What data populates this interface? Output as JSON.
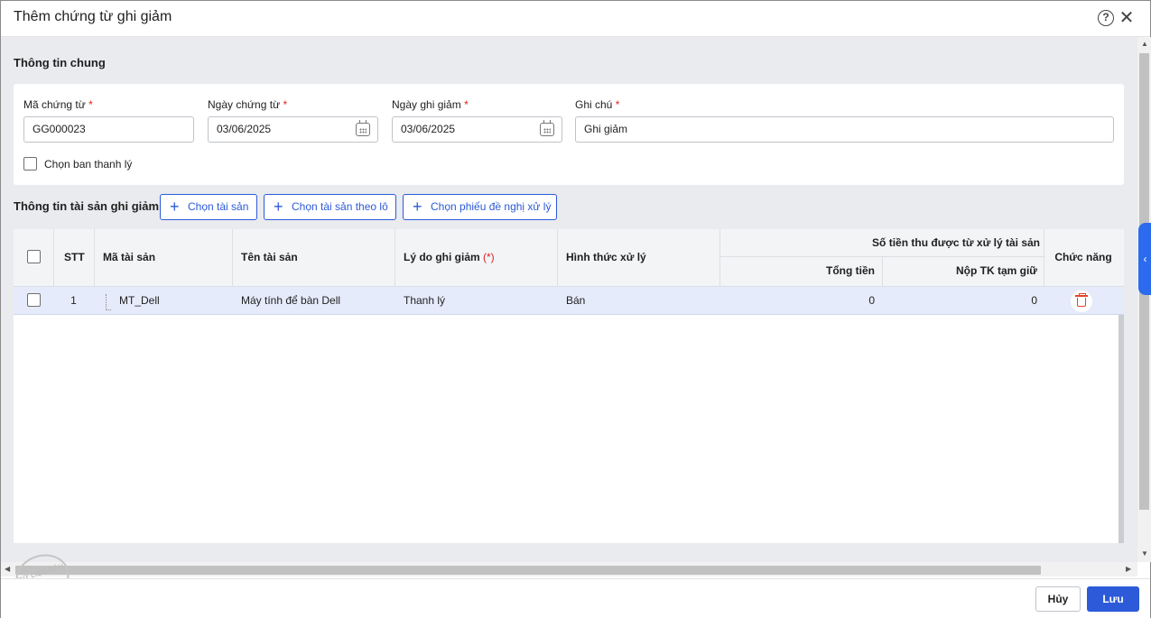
{
  "header": {
    "title": "Thêm chứng từ ghi giảm"
  },
  "general": {
    "title": "Thông tin chung",
    "voucher_code": {
      "label": "Mã chứng từ",
      "value": "GG000023"
    },
    "voucher_date": {
      "label": "Ngày chứng từ",
      "value": "03/06/2025"
    },
    "decrease_date": {
      "label": "Ngày ghi giảm",
      "value": "03/06/2025"
    },
    "note": {
      "label": "Ghi chú",
      "value": "Ghi giảm"
    },
    "required_mark": "*",
    "board_checkbox_label": "Chọn ban thanh lý"
  },
  "assets": {
    "title": "Thông tin tài sản ghi giảm",
    "buttons": {
      "choose_asset": "Chọn tài sản",
      "choose_by_batch": "Chọn tài sản theo lô",
      "choose_proposal": "Chọn phiếu đề nghị xử lý"
    },
    "columns": {
      "stt": "STT",
      "code": "Mã tài sản",
      "name": "Tên tài sản",
      "reason": "Lý do ghi giảm",
      "reason_req": "(*)",
      "method": "Hình thức xử lý",
      "money_group": "Số tiền thu được từ xử lý tài sản",
      "total": "Tổng tiền",
      "deposit": "Nộp TK tạm giữ",
      "actions": "Chức năng",
      "overflow": "nộ"
    },
    "rows": [
      {
        "stt": "1",
        "code": "MT_Dell",
        "name": "Máy tính để bàn Dell",
        "reason": "Thanh lý",
        "method": "Bán",
        "total": "0",
        "deposit": "0"
      }
    ]
  },
  "footer": {
    "cancel": "Hủy",
    "save": "Lưu"
  },
  "watermark": "DỮ LIỆU MẪU",
  "icons": {
    "help": "help-circle-icon",
    "close": "close-icon",
    "calendar": "calendar-icon",
    "delete": "trash-icon",
    "collapse": "chevron-left-icon"
  },
  "colors": {
    "primary": "#2c5ad8",
    "danger": "#e0452a",
    "row_selected": "#e6ebfb"
  }
}
